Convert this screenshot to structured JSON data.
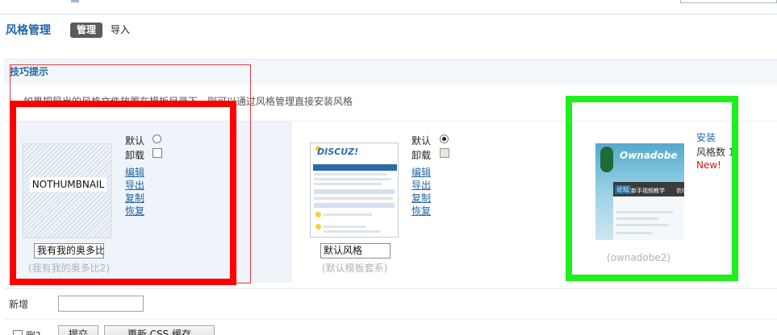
{
  "header": {
    "title": "风格管理",
    "tabs": [
      {
        "label": "管理",
        "active": true
      },
      {
        "label": "导入",
        "active": false
      }
    ]
  },
  "tips": {
    "title": "技巧提示",
    "lines": [
      "如果把导出的风格文件放置在模板目录下，则可以通过风格管理直接安装风格"
    ]
  },
  "styles": [
    {
      "thumbnail_text": "NOTHUMBNAIL",
      "name_value": "我有我的奥多比",
      "subtitle": "(我有我的奥多比2)",
      "default_label": "默认",
      "default_selected": false,
      "uninstall_label": "卸载",
      "uninstall_disabled": false,
      "actions": [
        "编辑",
        "导出",
        "复制",
        "恢复"
      ]
    },
    {
      "thumbnail_text": "DISCUZ!",
      "name_value": "默认风格",
      "subtitle": "(默认模板套系)",
      "default_label": "默认",
      "default_selected": true,
      "uninstall_label": "卸载",
      "uninstall_disabled": true,
      "actions": [
        "编辑",
        "导出",
        "复制",
        "恢复"
      ]
    }
  ],
  "available_style": {
    "logo_text": "Ownadobe",
    "nav_tab": "论坛",
    "nav_text": "新手视频教学　　农Own",
    "subtitle": "(ownadobe2)",
    "install_label": "安装",
    "count_label": "风格数 1",
    "new_badge": "New!"
  },
  "add_form": {
    "label": "新增",
    "value": ""
  },
  "footer": {
    "delete_label": "删?",
    "submit_label": "提交",
    "update_css_label": "更新 CSS 缓存"
  },
  "colors": {
    "accent": "#2366a8",
    "annotation_red": "#ff0000",
    "annotation_green": "#1ef01e",
    "new_badge": "#d21818"
  }
}
